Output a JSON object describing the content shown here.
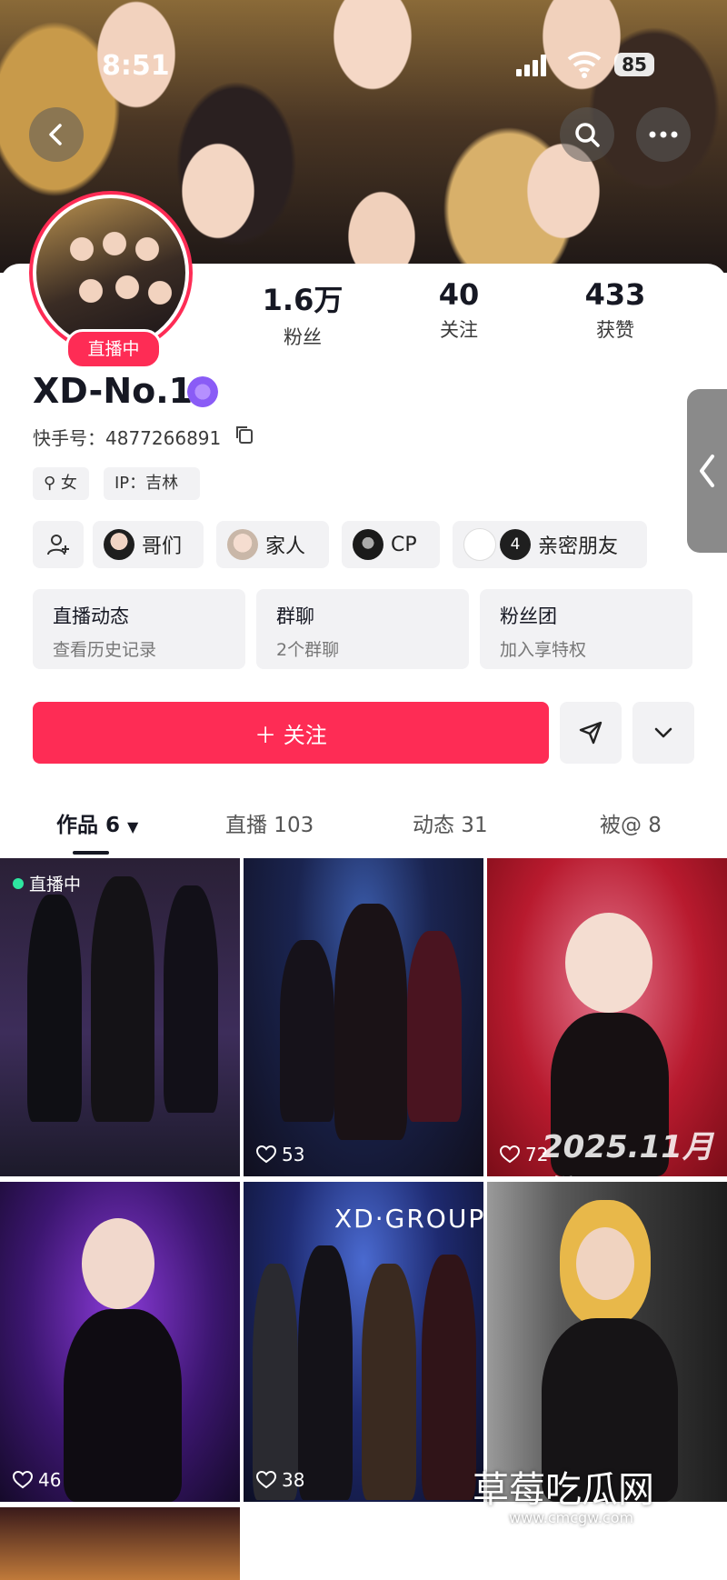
{
  "status_bar": {
    "time": "8:51",
    "battery": "85"
  },
  "profile": {
    "live_badge": "直播中",
    "stats": [
      {
        "value": "1.6万",
        "label": "粉丝"
      },
      {
        "value": "40",
        "label": "关注"
      },
      {
        "value": "433",
        "label": "获赞"
      }
    ],
    "name": "XD-No.1",
    "uid": "快手号：4877266891",
    "tags": [
      "女",
      "IP：吉林"
    ],
    "relations": [
      "哥们",
      "家人",
      "CP",
      "亲密朋友"
    ],
    "relation_count": "4",
    "info_cards": [
      {
        "title": "直播动态",
        "subtitle": "查看历史记录"
      },
      {
        "title": "群聊",
        "subtitle": "2个群聊"
      },
      {
        "title": "粉丝团",
        "subtitle": "加入享特权"
      }
    ],
    "follow_label": "＋ 关注"
  },
  "tabs": [
    "作品 6",
    "直播 103",
    "动态 31",
    "被@ 8"
  ],
  "grid": [
    {
      "likes": "",
      "overlay": "直播中"
    },
    {
      "likes": "53",
      "overlay": ""
    },
    {
      "likes": "72",
      "overlay": "2025.11月份"
    },
    {
      "likes": "46",
      "overlay": ""
    },
    {
      "likes": "38",
      "overlay": "XD·GROUP"
    },
    {
      "likes": "",
      "overlay": ""
    }
  ],
  "watermark": {
    "title": "草莓吃瓜网",
    "url": "www.cmcgw.com"
  },
  "colors": {
    "accent": "#fe2c55",
    "chip_bg": "#f2f2f4"
  },
  "icons": [
    "back-arrow-icon",
    "search-icon",
    "more-icon",
    "copy-icon",
    "add-friend-icon",
    "share-send-icon",
    "chevron-down-icon",
    "heart-icon"
  ]
}
